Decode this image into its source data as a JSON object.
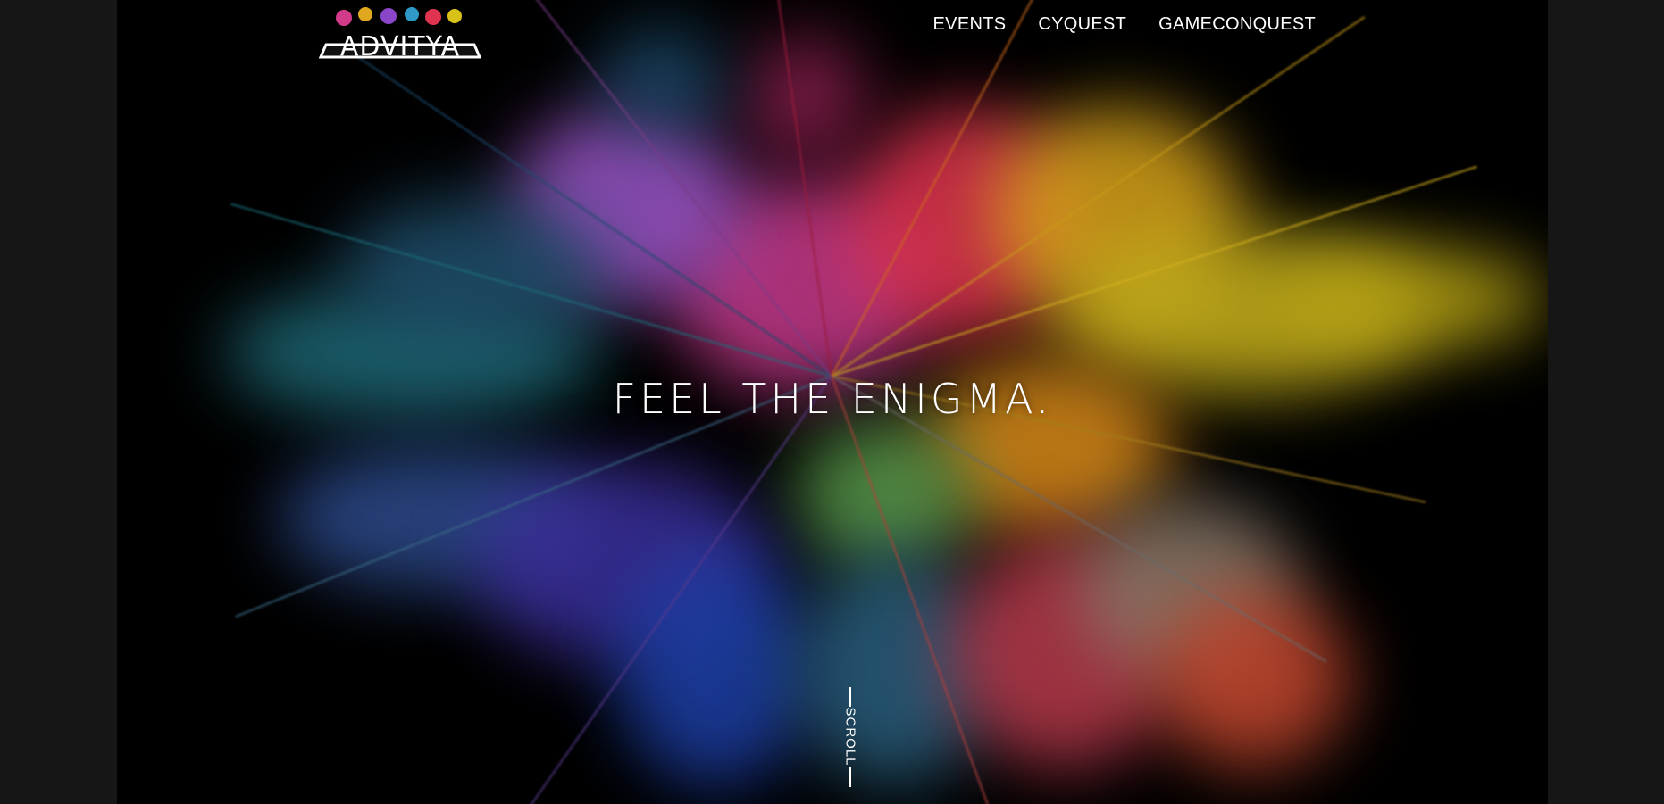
{
  "brand": {
    "logo_text": "ADVITYA"
  },
  "nav": {
    "items": [
      {
        "label": "EVENTS"
      },
      {
        "label": "CYQUEST"
      },
      {
        "label": "GAMECONQUEST"
      }
    ]
  },
  "hero": {
    "headline": "FEEL THE ENIGMA.",
    "scroll_label": "SCROLL",
    "background": "color-powder-explosion",
    "colors": {
      "frame": "#000000",
      "outer": "#161616",
      "text": "#ffffff"
    }
  }
}
